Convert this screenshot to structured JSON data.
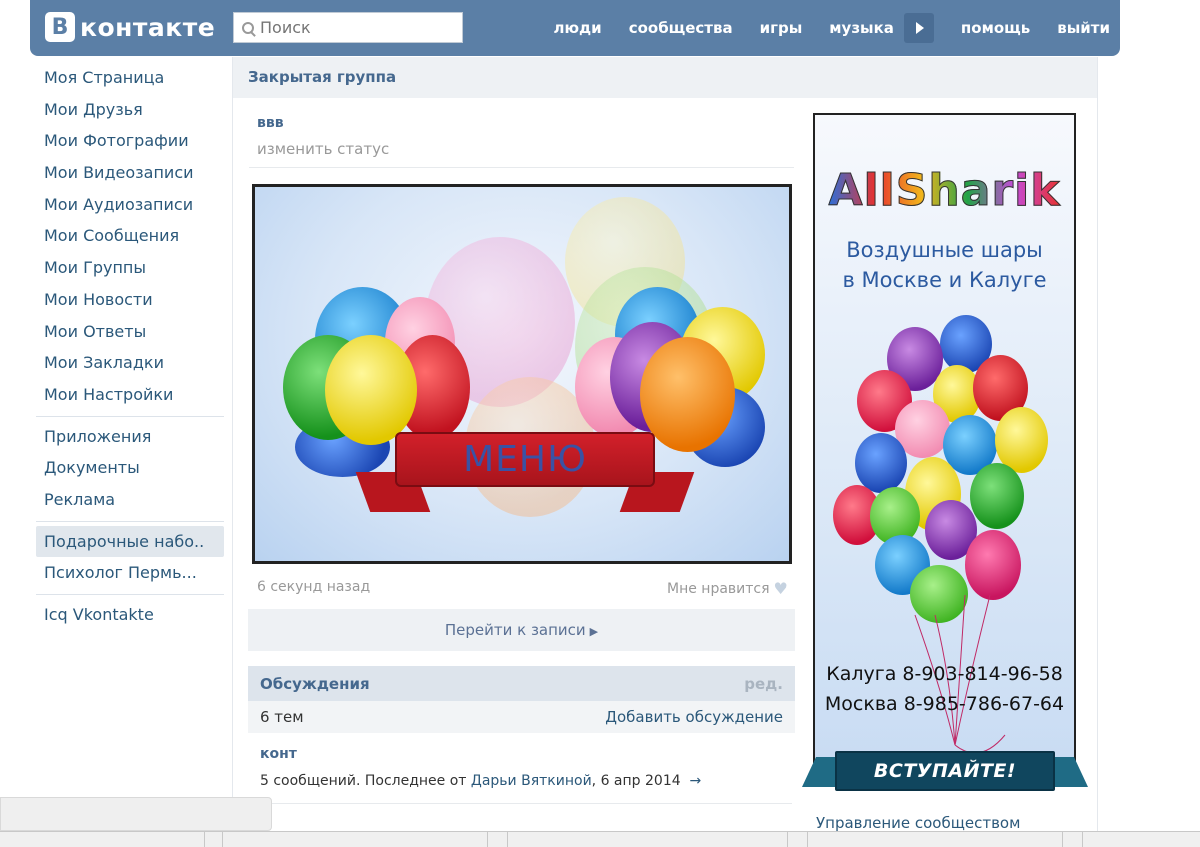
{
  "header": {
    "logo_letter": "В",
    "logo_text": "контакте",
    "search_placeholder": "Поиск",
    "nav": [
      "люди",
      "сообщества",
      "игры",
      "музыка",
      "помощь",
      "выйти"
    ]
  },
  "left_menu": {
    "main": [
      "Моя Страница",
      "Мои Друзья",
      "Мои Фотографии",
      "Мои Видеозаписи",
      "Мои Аудиозаписи",
      "Мои Сообщения",
      "Мои Группы",
      "Мои Новости",
      "Мои Ответы",
      "Мои Закладки",
      "Мои Настройки"
    ],
    "apps": [
      "Приложения",
      "Документы",
      "Реклама"
    ],
    "groups": [
      "Подарочные набо..",
      "Психолог Пермь..."
    ],
    "extra": [
      "Icq Vkontakte"
    ]
  },
  "content": {
    "header": "Закрытая группа",
    "group_name": "ввв",
    "status": "изменить статус",
    "banner_text": "МЕНЮ",
    "post_time": "6 секунд назад",
    "like": "Мне нравится",
    "goto_post": "Перейти к записи",
    "discussions": {
      "title": "Обсуждения",
      "edit": "ред.",
      "count": "6 тем",
      "add": "Добавить обсуждение",
      "topic_title": "конт",
      "topic_info_prefix": "5 сообщений. Последнее от ",
      "topic_author": "Дарьи Вяткиной",
      "topic_date": ", 6 апр 2014",
      "topic_arrow": "→"
    }
  },
  "ad": {
    "logo": "AllSharik",
    "tagline1": "Воздушные шары",
    "tagline2": "в Москве и Калуге",
    "phone1": "Калуга 8-903-814-96-58",
    "phone2": "Москва 8-985-786-67-64",
    "join": "ВСТУПАЙТЕ!",
    "manage": "Управление сообществом"
  },
  "colors": {
    "header_bg": "#5b7fa6",
    "link": "#2b587a",
    "title": "#45688e"
  }
}
